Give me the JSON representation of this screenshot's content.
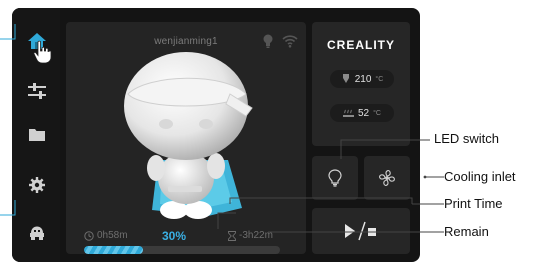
{
  "header": {
    "filename": "wenjianming1"
  },
  "brand": "CREALITY",
  "temperatures": {
    "nozzle": {
      "value": "210",
      "unit": "°C"
    },
    "bed": {
      "value": "52",
      "unit": "°C"
    }
  },
  "progress": {
    "elapsed": "0h58m",
    "percent_label": "30%",
    "fraction": 0.3,
    "remaining": "-3h22m"
  },
  "sidebar": {
    "items": [
      {
        "icon": "home-icon"
      },
      {
        "icon": "sliders-icon"
      },
      {
        "icon": "folder-icon"
      },
      {
        "icon": "gear-icon"
      },
      {
        "icon": "robot-icon"
      }
    ]
  },
  "controls": {
    "led_icon": "lightbulb-icon",
    "fan_icon": "fan-icon",
    "play_pause_icon": "play-stop-icon"
  },
  "annotations": {
    "led_switch": "LED switch",
    "cooling_inlet": "Cooling inlet",
    "print_time": "Print Time",
    "remain": "Remain"
  },
  "colors": {
    "accent": "#2fa9d8",
    "percent_text": "#3ab0e4",
    "background": "#141414",
    "panel": "#242424"
  }
}
